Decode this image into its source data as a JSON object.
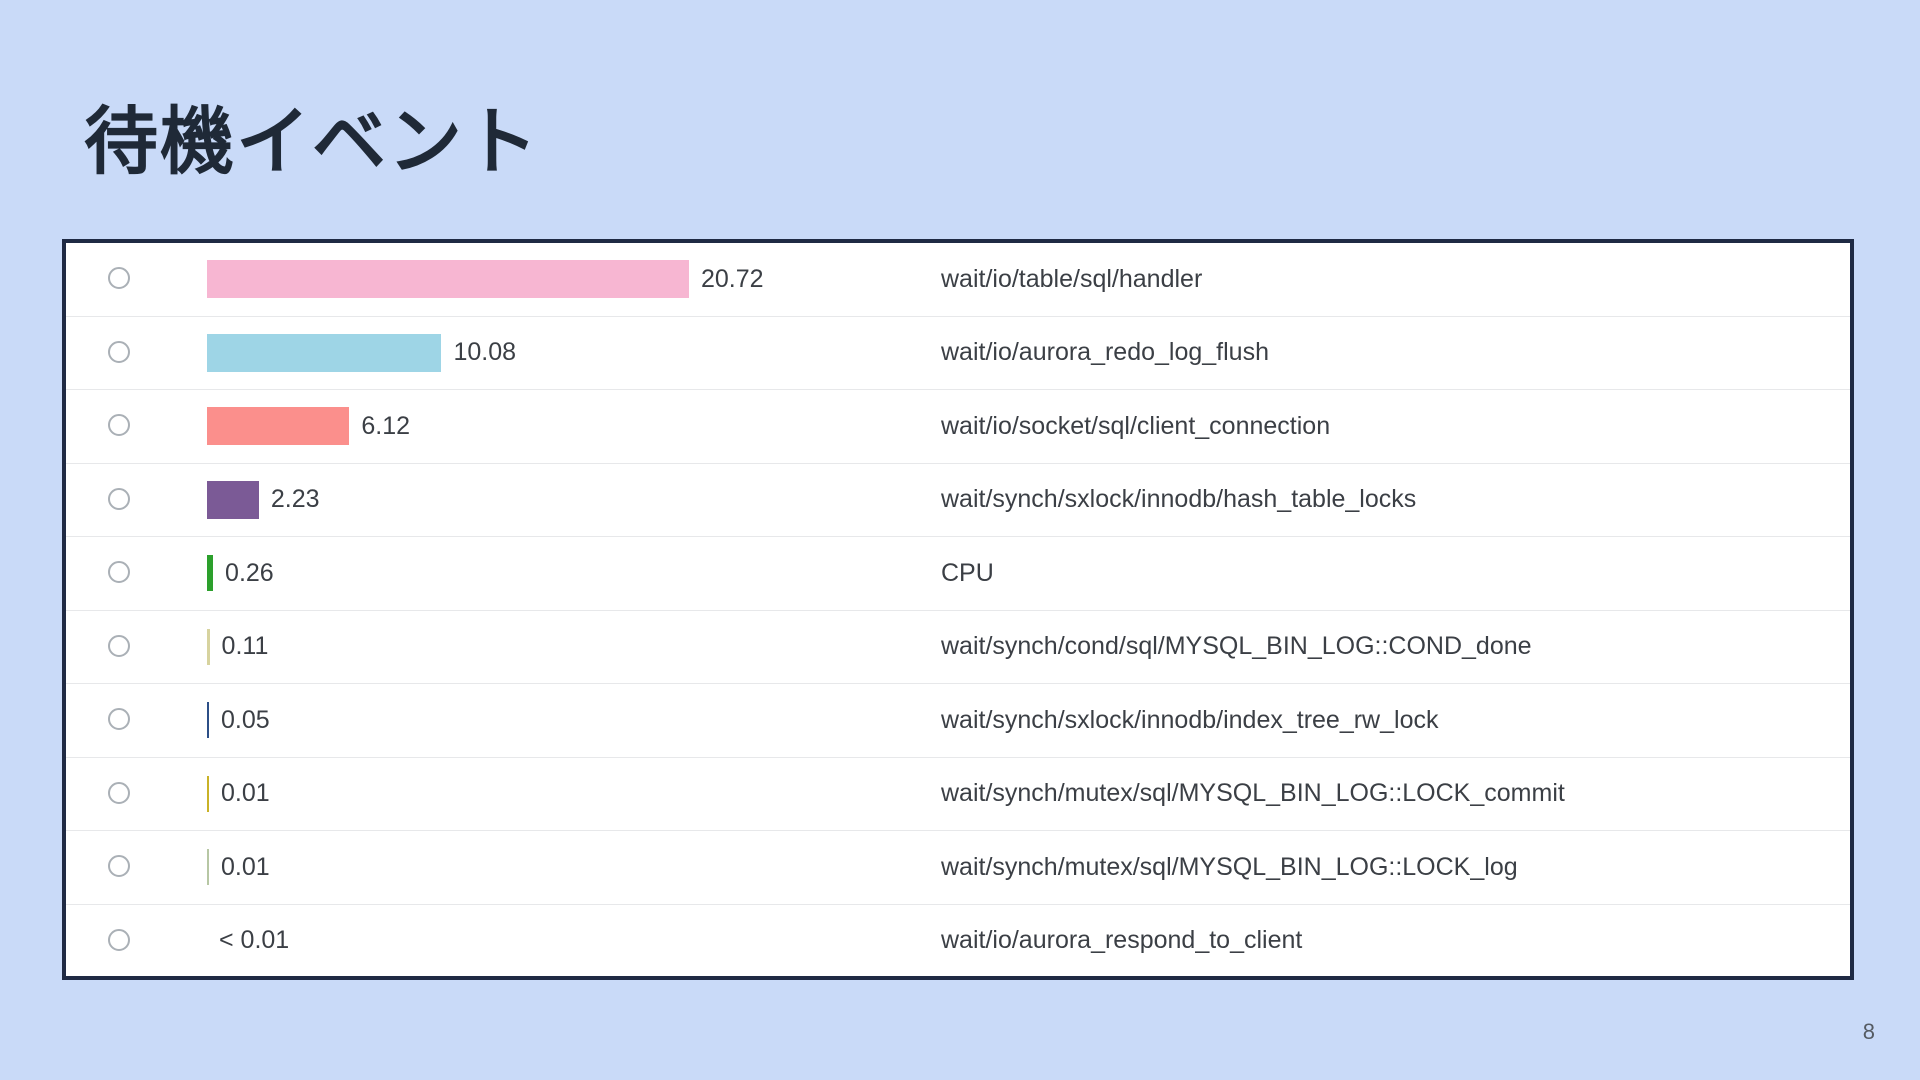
{
  "slide": {
    "title": "待機イベント",
    "page_number": "8"
  },
  "chart_data": {
    "type": "bar",
    "orientation": "horizontal",
    "xlim": [
      0,
      20.72
    ],
    "rows": [
      {
        "value": 20.72,
        "label": "20.72",
        "event": "wait/io/table/sql/handler",
        "color": "#f7b6d2"
      },
      {
        "value": 10.08,
        "label": "10.08",
        "event": "wait/io/aurora_redo_log_flush",
        "color": "#9ed5e6"
      },
      {
        "value": 6.12,
        "label": "6.12",
        "event": "wait/io/socket/sql/client_connection",
        "color": "#fb8f8c"
      },
      {
        "value": 2.23,
        "label": "2.23",
        "event": "wait/synch/sxlock/innodb/hash_table_locks",
        "color": "#7b5a96"
      },
      {
        "value": 0.26,
        "label": "0.26",
        "event": "CPU",
        "color": "#2ca02c"
      },
      {
        "value": 0.11,
        "label": "0.11",
        "event": "wait/synch/cond/sql/MYSQL_BIN_LOG::COND_done",
        "color": "#d7d39f"
      },
      {
        "value": 0.05,
        "label": "0.05",
        "event": "wait/synch/sxlock/innodb/index_tree_rw_lock",
        "color": "#2c4f87"
      },
      {
        "value": 0.01,
        "label": "0.01",
        "event": "wait/synch/mutex/sql/MYSQL_BIN_LOG::LOCK_commit",
        "color": "#c9b227"
      },
      {
        "value": 0.01,
        "label": "0.01",
        "event": "wait/synch/mutex/sql/MYSQL_BIN_LOG::LOCK_log",
        "color": "#b7c7a4"
      },
      {
        "value": 0.0,
        "label": "< 0.01",
        "event": "wait/io/aurora_respond_to_client",
        "color": "#ffffff"
      }
    ]
  }
}
